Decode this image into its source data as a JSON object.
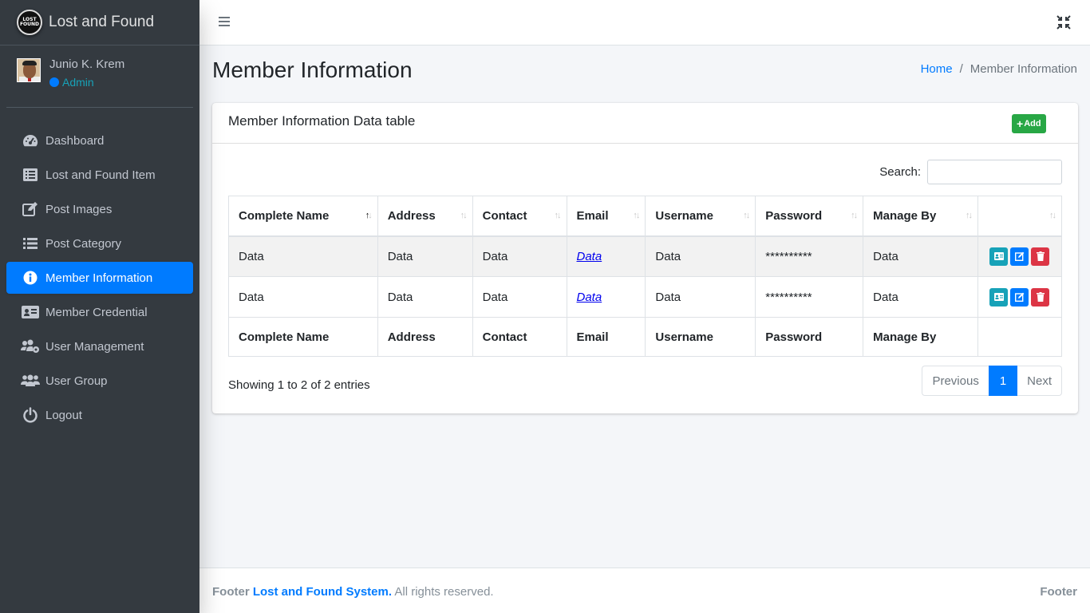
{
  "brand": {
    "name": "Lost and Found",
    "logo_text_1": "LOST",
    "logo_text_2": "FOUND"
  },
  "user": {
    "name": "Junio K. Krem",
    "role": "Admin"
  },
  "sidebar": {
    "items": [
      {
        "label": "Dashboard",
        "icon": "dashboard-icon",
        "active": false
      },
      {
        "label": "Lost and Found Item",
        "icon": "list-icon",
        "active": false
      },
      {
        "label": "Post Images",
        "icon": "edit-icon",
        "active": false
      },
      {
        "label": "Post Category",
        "icon": "list-ul-icon",
        "active": false
      },
      {
        "label": "Member Information",
        "icon": "info-icon",
        "active": true
      },
      {
        "label": "Member Credential",
        "icon": "id-card-icon",
        "active": false
      },
      {
        "label": "User Management",
        "icon": "users-cog-icon",
        "active": false
      },
      {
        "label": "User Group",
        "icon": "users-icon",
        "active": false
      },
      {
        "label": "Logout",
        "icon": "power-icon",
        "active": false
      }
    ]
  },
  "header": {
    "title": "Member Information",
    "breadcrumb_home": "Home",
    "breadcrumb_sep": "/",
    "breadcrumb_current": "Member Information"
  },
  "card": {
    "title": "Member Information Data table",
    "add_label": "Add"
  },
  "search": {
    "label": "Search:",
    "value": ""
  },
  "table": {
    "columns": [
      "Complete Name",
      "Address",
      "Contact",
      "Email",
      "Username",
      "Password",
      "Manage By"
    ],
    "rows": [
      [
        "Data",
        "Data",
        "Data",
        "Data",
        "Data",
        "**********",
        "Data"
      ],
      [
        "Data",
        "Data",
        "Data",
        "Data",
        "Data",
        "**********",
        "Data"
      ]
    ]
  },
  "pagination": {
    "info": "Showing 1 to 2 of 2 entries",
    "previous": "Previous",
    "current": "1",
    "next": "Next"
  },
  "footer": {
    "prefix": "Footer",
    "system": "Lost and Found System.",
    "rights": "All rights reserved.",
    "right": "Footer"
  },
  "colors": {
    "sidebar_bg": "#343a40",
    "accent": "#007bff",
    "success": "#28a745",
    "info": "#17a2b8",
    "danger": "#dc3545"
  }
}
